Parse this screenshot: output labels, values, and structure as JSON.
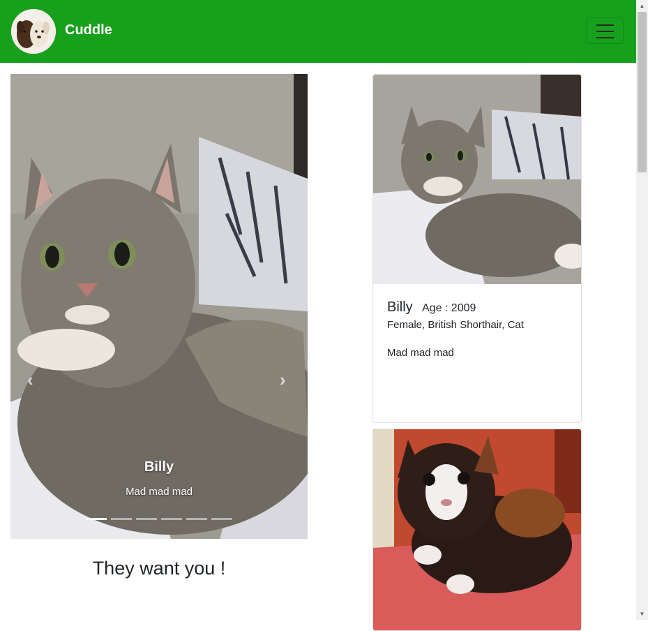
{
  "navbar": {
    "brand": "Cuddle",
    "logo_icon": "puppies-logo-icon",
    "toggler_icon": "hamburger-menu-icon",
    "background": "#17a01c"
  },
  "carousel": {
    "caption_title": "Billy",
    "caption_text": "Mad mad mad",
    "prev_icon": "‹",
    "next_icon": "›",
    "slide_count": 6,
    "active_slide": 1
  },
  "tagline": "They want you !",
  "cards": [
    {
      "name": "Billy",
      "age": "Age : 2009",
      "details": "Female, British Shorthair, Cat",
      "description": "Mad mad mad"
    },
    {
      "name": "",
      "age": "",
      "details": "",
      "description": ""
    }
  ],
  "scrollbar": {
    "up_icon": "▲",
    "down_icon": "▼"
  }
}
